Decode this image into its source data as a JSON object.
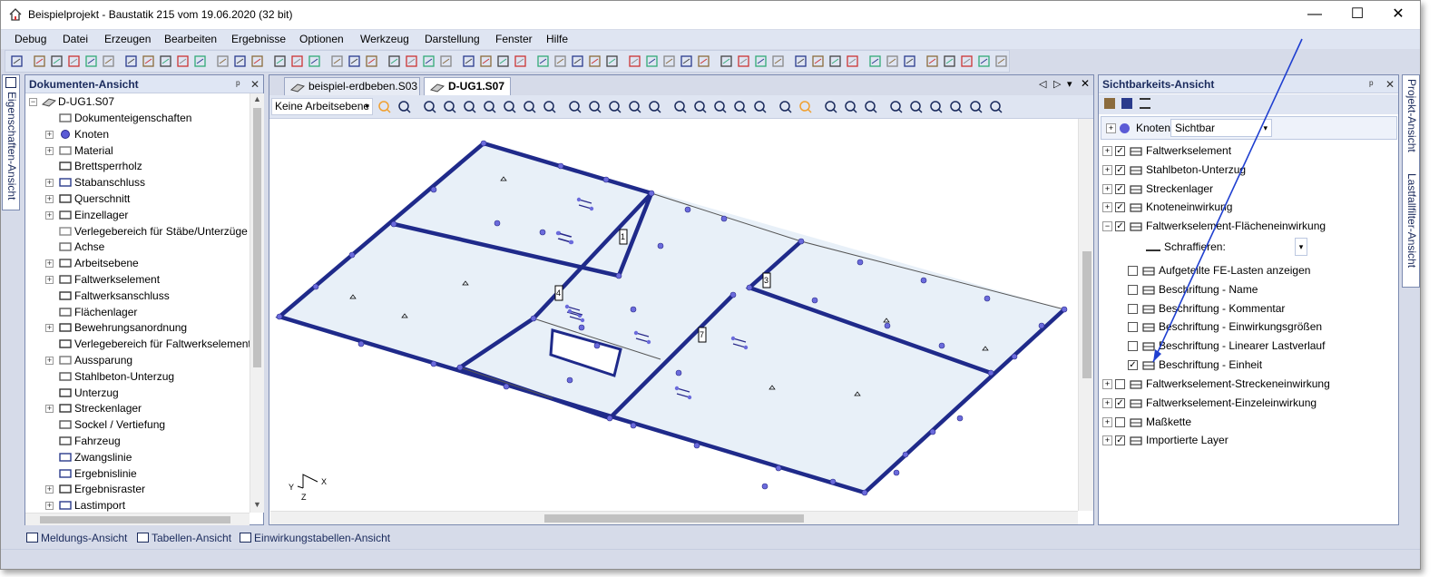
{
  "window": {
    "title": "Beispielprojekt - Baustatik 215 vom 19.06.2020 (32 bit)",
    "minimize": "—",
    "maximize": "☐",
    "close": "✕"
  },
  "menu": [
    "Debug",
    "Datei",
    "Erzeugen",
    "Bearbeiten",
    "Ergebnisse",
    "Optionen",
    "Werkzeug",
    "Darstellung",
    "Fenster",
    "Hilfe"
  ],
  "doc_panel": {
    "title": "Dokumenten-Ansicht",
    "pin": "ᵖ",
    "close": "✕",
    "root": "D-UG1.S07",
    "items": [
      "Dokumenteigenschaften",
      "Knoten",
      "Material",
      "Brettsperrholz",
      "Stabanschluss",
      "Querschnitt",
      "Einzellager",
      "Verlegebereich für Stäbe/Unterzüge",
      "Achse",
      "Arbeitsebene",
      "Faltwerkselement",
      "Faltwerksanschluss",
      "Flächenlager",
      "Bewehrungsanordnung",
      "Verlegebereich für Faltwerkselement",
      "Aussparung",
      "Stahlbeton-Unterzug",
      "Unterzug",
      "Streckenlager",
      "Sockel / Vertiefung",
      "Fahrzeug",
      "Zwangslinie",
      "Ergebnislinie",
      "Ergebnisraster",
      "Lastimport"
    ]
  },
  "side_left": {
    "label": "Eigenschaften-Ansicht"
  },
  "side_right": {
    "label1": "Projekt-Ansicht",
    "label2": "Lastfallfilter-Ansicht"
  },
  "tabs": [
    {
      "label": "beispiel-erdbeben.S03"
    },
    {
      "label": "D-UG1.S07"
    }
  ],
  "view_toolbar": {
    "arbeitsebene": "Keine Arbeitsebene"
  },
  "axes": {
    "x": "X",
    "y": "Y",
    "z": "Z"
  },
  "labels": {
    "l1": "1",
    "l3": "3",
    "l4": "4",
    "l7": "7"
  },
  "vis_panel": {
    "title": "Sichtbarkeits-Ansicht",
    "knoten_label": "Knoten:",
    "knoten_value": "Sichtbar",
    "schraffieren": "Schraffieren:",
    "items": [
      {
        "label": "Faltwerkselement",
        "checked": "✓"
      },
      {
        "label": "Stahlbeton-Unterzug",
        "checked": "✓"
      },
      {
        "label": "Streckenlager",
        "checked": "✓"
      },
      {
        "label": "Knoteneinwirkung",
        "checked": "✓"
      },
      {
        "label": "Faltwerkselement-Flächeneinwirkung",
        "checked": "✓"
      }
    ],
    "sub": [
      {
        "label": "Aufgeteilte FE-Lasten anzeigen",
        "checked": ""
      },
      {
        "label": "Beschriftung - Name",
        "checked": ""
      },
      {
        "label": "Beschriftung - Kommentar",
        "checked": ""
      },
      {
        "label": "Beschriftung - Einwirkungsgrößen",
        "checked": ""
      },
      {
        "label": "Beschriftung - Linearer Lastverlauf",
        "checked": ""
      },
      {
        "label": "Beschriftung - Einheit",
        "checked": "✓"
      }
    ],
    "items2": [
      {
        "label": "Faltwerkselement-Streckeneinwirkung",
        "checked": ""
      },
      {
        "label": "Faltwerkselement-Einzeleinwirkung",
        "checked": "✓"
      },
      {
        "label": "Maßkette",
        "checked": ""
      },
      {
        "label": "Importierte Layer",
        "checked": "✓"
      }
    ]
  },
  "bottom_tabs": [
    "Meldungs-Ansicht",
    "Tabellen-Ansicht",
    "Einwirkungstabellen-Ansicht"
  ],
  "colors": {
    "accent": "#1f2a8a",
    "arrow": "#1f3fd0",
    "frame": "#d6dbe9"
  }
}
